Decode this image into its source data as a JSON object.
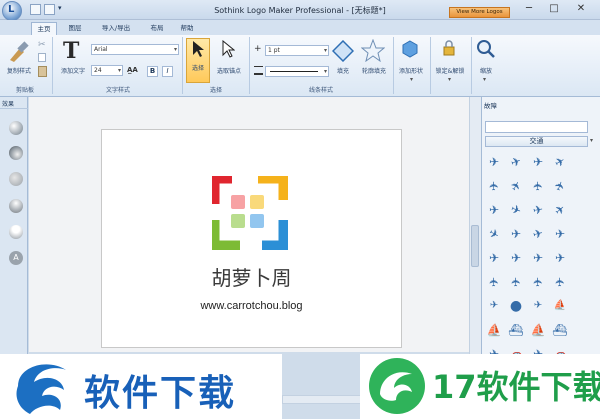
{
  "window": {
    "title": "Sothink Logo Maker Professional - [无标题*]",
    "view_more": "View More Logos",
    "minimize": "─",
    "maximize": "□",
    "close": "✕"
  },
  "tabs": [
    "主页",
    "图层",
    "导入/导出",
    "布局",
    "帮助"
  ],
  "ribbon": {
    "clipboard": {
      "copy_style": "复制样式",
      "group": "剪贴板"
    },
    "text": {
      "add_text": "添加文字",
      "font": "Arial",
      "size": "24",
      "group": "文字样式"
    },
    "select": {
      "select": "选择",
      "select_anchor": "选取锚点",
      "group": "选择"
    },
    "line": {
      "width": "1 pt",
      "fill": "填充",
      "contour_fill": "轮廓填充",
      "group": "线条样式"
    },
    "shape": {
      "add_shape": "添加形状",
      "lock_unlock": "锁定&解锁"
    },
    "zoom": {
      "zoom": "缩放"
    }
  },
  "left_panel": {
    "title": "效果"
  },
  "canvas": {
    "logo_title": "胡萝卜周",
    "logo_url": "www.carrotchou.blog",
    "colors": {
      "red": "#e0262f",
      "green": "#7dbb35",
      "blue": "#2b8fd6",
      "yellow": "#f5b21b"
    }
  },
  "right_panel": {
    "title": "故障",
    "category": "交通"
  },
  "watermark": {
    "left": "软件下载",
    "right": "17软件下载"
  }
}
